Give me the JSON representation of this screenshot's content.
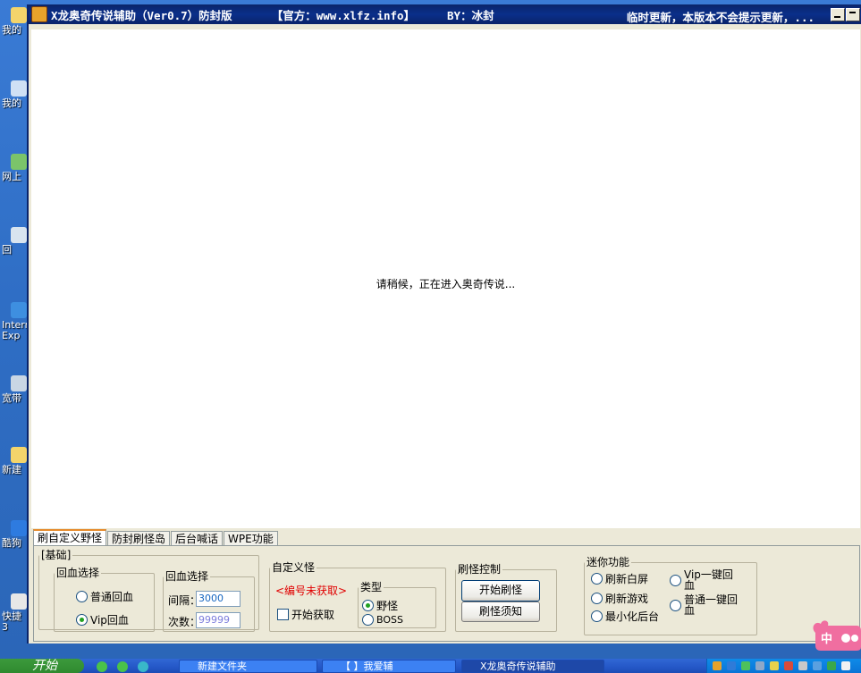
{
  "window": {
    "title": "X龙奥奇传说辅助（Ver0.7）防封版",
    "site": "【官方：www.xlfz.info】",
    "author": "BY：冰封",
    "notice": "临时更新，本版本不会提示更新，..."
  },
  "content": {
    "loading_text": "请稍候，正在进入奥奇传说..."
  },
  "tabs": [
    "刷自定义野怪",
    "防封刷怪岛",
    "后台喊话",
    "WPE功能"
  ],
  "panel": {
    "basic": {
      "legend": "[基础]",
      "heal_mode": {
        "legend": "回血选择",
        "options": [
          {
            "label": "普通回血",
            "selected": false
          },
          {
            "label": "Vip回血",
            "selected": true
          }
        ]
      },
      "heal_settings": {
        "legend": "回血选择",
        "interval_label": "间隔：",
        "interval_value": "3000",
        "count_label": "次数：",
        "count_value": "99999"
      }
    },
    "custom_monster": {
      "legend": "自定义怪",
      "status": "<编号未获取>",
      "start_fetch": "开始获取",
      "type": {
        "legend": "类型",
        "options": [
          {
            "label": "野怪",
            "selected": true
          },
          {
            "label": "BOSS",
            "selected": false
          }
        ]
      }
    },
    "control": {
      "legend": "刷怪控制",
      "start_button": "开始刷怪",
      "notes_button": "刷怪须知"
    },
    "mini": {
      "legend": "迷你功能",
      "options": [
        "刷新白屏",
        "Vip一键回血",
        "刷新游戏",
        "普通一键回血",
        "最小化后台"
      ]
    }
  },
  "taskbar": {
    "start_label": "开始",
    "tasks": [
      "新建文件夹",
      "【 】我爱辅",
      "X龙奥奇传说辅助"
    ]
  },
  "desktop_icons": [
    "我的",
    "我的",
    "网上",
    "回",
    "Internet Exp",
    "宽带",
    "新建",
    "酷狗",
    "快捷 3"
  ],
  "ime": {
    "label": "中"
  },
  "colors": {
    "titlebar": "#0a246a",
    "warning_text": "#e00000",
    "tab_accent": "#e68b2c"
  }
}
